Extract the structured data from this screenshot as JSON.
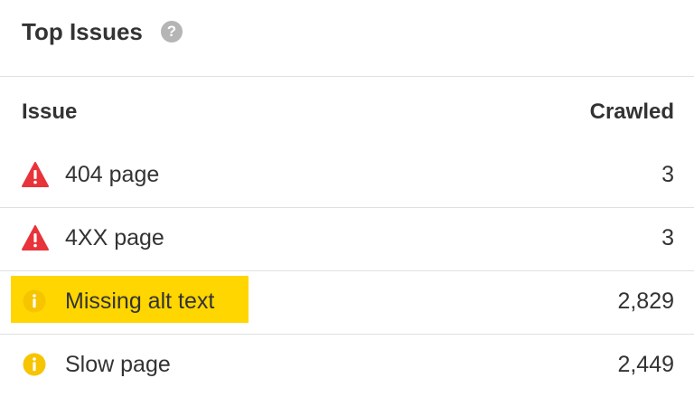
{
  "panel": {
    "title": "Top Issues",
    "help_glyph": "?"
  },
  "table": {
    "columns": {
      "issue": "Issue",
      "crawled": "Crawled"
    },
    "rows": [
      {
        "label": "404 page",
        "value": "3",
        "severity": "error",
        "icon": "warning-triangle-icon",
        "highlighted": false
      },
      {
        "label": "4XX page",
        "value": "3",
        "severity": "error",
        "icon": "warning-triangle-icon",
        "highlighted": false
      },
      {
        "label": "Missing alt text",
        "value": "2,829",
        "severity": "notice",
        "icon": "info-circle-icon",
        "highlighted": true
      },
      {
        "label": "Slow page",
        "value": "2,449",
        "severity": "notice",
        "icon": "info-circle-icon",
        "highlighted": false
      }
    ]
  },
  "colors": {
    "error": "#e8333a",
    "notice": "#f7c400",
    "highlight": "#ffd600",
    "text": "#333333",
    "divider": "#e0e0e0",
    "help_icon": "#b5b5b5"
  }
}
